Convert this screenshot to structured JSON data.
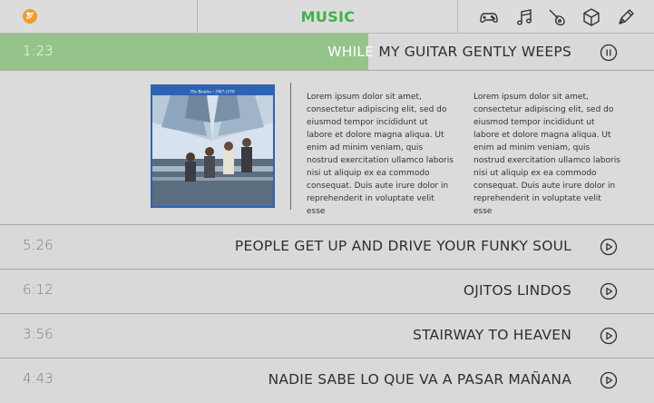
{
  "header": {
    "title": "MUSIC",
    "title_color": "#3fb24a",
    "logo_icon": "leaf-logo-icon",
    "logo_color": "#f29a2e",
    "icons": [
      "gamepad-icon",
      "music-notes-icon",
      "guitar-icon",
      "cube-icon",
      "pen-icon"
    ]
  },
  "now_playing": {
    "time": "1:23",
    "title_lead": "WHILE",
    "title_rest": "MY GUITAR GENTLY WEEPS",
    "progress": 0.563,
    "progress_color": "#95c48a",
    "control": "pause-icon"
  },
  "details": {
    "cover_caption": "The Beatles / 1967-1970",
    "text_col1": "Lorem ipsum dolor sit amet, consectetur adipiscing elit, sed do eiusmod tempor incididunt ut labore et dolore magna aliqua. Ut enim ad minim veniam, quis nostrud exercitation ullamco laboris nisi ut aliquip ex ea commodo consequat. Duis aute irure dolor in reprehenderit in voluptate velit esse",
    "text_col2": "Lorem ipsum dolor sit amet, consectetur adipiscing elit, sed do eiusmod tempor incididunt ut labore et dolore magna aliqua. Ut enim ad minim veniam, quis nostrud exercitation ullamco laboris nisi ut aliquip ex ea commodo consequat. Duis aute irure dolor in reprehenderit in voluptate velit esse"
  },
  "tracks": [
    {
      "time": "5:26",
      "title": "PEOPLE GET UP AND DRIVE YOUR FUNKY SOUL",
      "control": "play-icon"
    },
    {
      "time": "6:12",
      "title": "OJITOS LINDOS",
      "control": "play-icon"
    },
    {
      "time": "3:56",
      "title": "STAIRWAY TO HEAVEN",
      "control": "play-icon"
    },
    {
      "time": "4:43",
      "title": "NADIE SABE LO QUE VA A PASAR MAÑANA",
      "control": "play-icon"
    }
  ]
}
